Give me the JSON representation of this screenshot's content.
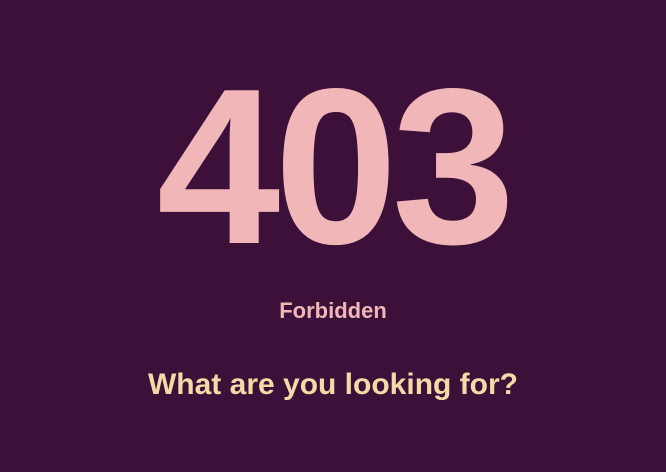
{
  "error": {
    "code": "403",
    "status": "Forbidden",
    "message": "What are you looking for?"
  },
  "colors": {
    "background": "#3c1038",
    "code": "#f0b6b8",
    "status": "#f0b6b8",
    "message": "#f7d9a8"
  }
}
